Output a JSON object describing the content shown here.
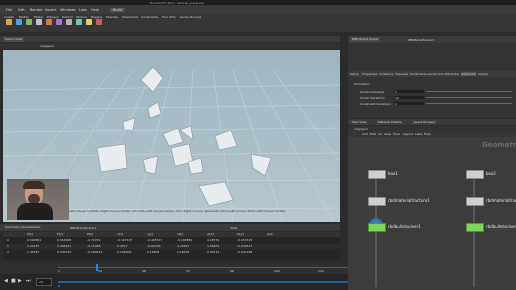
{
  "window": {
    "title": "Houdini FX 19.5 – tutorial_scene.hip"
  },
  "menubar": {
    "items": [
      "File",
      "Edit",
      "Render",
      "Assets",
      "Windows",
      "Labs",
      "Help"
    ],
    "workspace": "Build"
  },
  "shelf": {
    "tabs": [
      "Create",
      "Modify",
      "Model",
      "Polygon",
      "Deform",
      "Texture",
      "Rigging",
      "Muscles",
      "Characters",
      "Constraints",
      "Hair Utils",
      "Guide Process"
    ]
  },
  "viewport": {
    "pane_tab": "Scene View",
    "node_path": "/obj/geo1",
    "status": "Left mouse tumbles. Right mouse dollies. Ctrl+Alt+Left mouse zooms. Ctrl+Right mouse. Spacebar+Ctrl+Left mouse. Shift+Left mouse tumble"
  },
  "spreadsheet": {
    "tab": "Geometry Spreadsheet",
    "node": "RBDBulletSolver1",
    "view_label": "View",
    "headers": [
      "P[x]",
      "P[y]",
      "P[z]",
      "v[x]",
      "v[y]",
      "v[z]",
      "w[x]",
      "w[y]",
      "w[z]"
    ],
    "rows": [
      [
        "0",
        "0.594801",
        "0.544608",
        "-0.71074",
        "-0.107437",
        "-0.495517",
        "-0.190881",
        "4.28734",
        "-0.931674"
      ],
      [
        "1",
        "1.22187",
        "0.495611",
        "-0.71966",
        "0.4017",
        "-0.60746",
        "4.25847",
        "1.59979",
        "-0.932571"
      ],
      [
        "2",
        "1.42587",
        "0.530794",
        "-0.560411",
        "0.168004",
        "0.16808",
        "1.16093",
        "2.50119",
        "-0.941265"
      ]
    ]
  },
  "timeline": {
    "ticks": [
      "1",
      "24",
      "48",
      "72",
      "96",
      "120",
      "144",
      "168",
      "192",
      "216",
      "240"
    ],
    "current_frame": "24",
    "start": "1",
    "end": "240"
  },
  "params": {
    "node_title": "RBD Bullet Solver",
    "node_name": "RBDBulletSolver1",
    "tabs": [
      "Setup",
      "Properties",
      "Collisions",
      "Visualize",
      "Constraints",
      "Guide",
      "Sim Attributes",
      "Advanced",
      "Output"
    ],
    "section": "Simulation",
    "fields": [
      {
        "label": "Global Substeps",
        "value": "1"
      },
      {
        "label": "Solver Iterations",
        "value": "10"
      },
      {
        "label": "Constraint Iterations",
        "value": "1"
      }
    ]
  },
  "network": {
    "tabs": [
      "Tree View",
      "Material Palette",
      "Asset Browser"
    ],
    "path": "/obj/geo1",
    "menu": [
      "Add",
      "Edit",
      "Go",
      "View",
      "Tools",
      "Layout",
      "Labs",
      "Help"
    ],
    "context_label": "Geometry",
    "nodes": [
      {
        "name": "box1",
        "color": "#d2d2d2"
      },
      {
        "name": "rbdmaterialfracture1",
        "color": "#d2d2d2"
      },
      {
        "name": "rbdbulletsolver1",
        "color": "#7fd65b"
      },
      {
        "name": "box2",
        "color": "#d2d2d2"
      },
      {
        "name": "rbdmaterialfracture2",
        "color": "#d2d2d2"
      },
      {
        "name": "rbdbulletsolver2",
        "color": "#7fd65b"
      }
    ]
  },
  "colors": {
    "accent_blue": "#2a8ad8",
    "solver_green": "#7fd65b",
    "viewport_bg": "#a9bec7"
  }
}
